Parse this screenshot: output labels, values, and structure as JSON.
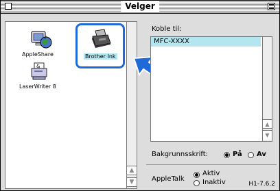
{
  "window": {
    "title": "Velger"
  },
  "devices": [
    {
      "name": "AppleShare",
      "icon": "appleshare-icon",
      "selected": false
    },
    {
      "name": "Brother Ink",
      "icon": "printer-icon",
      "selected": true
    },
    {
      "name": "LaserWriter 8",
      "icon": "laserwriter-icon",
      "selected": false
    }
  ],
  "connect": {
    "label": "Koble til:",
    "ports": [
      "MFC-XXXX"
    ]
  },
  "background_printing": {
    "label": "Bakgrunnsskrift:",
    "options": [
      "På",
      "Av"
    ],
    "selected": "På"
  },
  "appletalk": {
    "label": "AppleTalk",
    "options": [
      "Aktiv",
      "Inaktiv"
    ],
    "selected": "Aktiv"
  },
  "version": "H1-7.6.2",
  "colors": {
    "highlight": "#1f6ad8",
    "selection": "#b3e6ef",
    "arrow": "#1f6ad8"
  }
}
